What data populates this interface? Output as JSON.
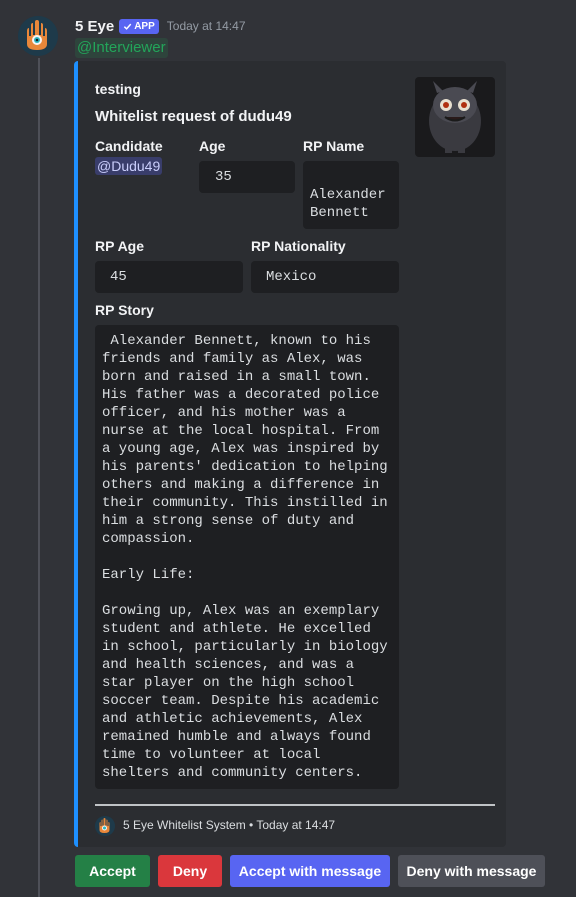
{
  "message": {
    "username": "5 Eye",
    "badge": "APP",
    "timestamp": "Today at 14:47",
    "mention": "@Interviewer"
  },
  "embed": {
    "accent_color": "#1e90ff",
    "author": "testing",
    "title": "Whitelist request of dudu49",
    "fields": {
      "candidate": {
        "name": "Candidate",
        "value": "@Dudu49"
      },
      "age": {
        "name": "Age",
        "value": "35"
      },
      "rp_name": {
        "name": "RP Name",
        "value_line1": "Alexander",
        "value_line2": "Bennett"
      },
      "rp_age": {
        "name": "RP Age",
        "value": "45"
      },
      "rp_nationality": {
        "name": "RP Nationality",
        "value": "Mexico"
      },
      "rp_story": {
        "name": "RP Story",
        "value": " Alexander Bennett, known to his\nfriends and family as Alex, was\nborn and raised in a small town.\nHis father was a decorated police\nofficer, and his mother was a\nnurse at the local hospital. From\na young age, Alex was inspired by\nhis parents' dedication to helping\nothers and making a difference in\ntheir community. This instilled in\nhim a strong sense of duty and\ncompassion.\n\nEarly Life:\n\nGrowing up, Alex was an exemplary\nstudent and athlete. He excelled\nin school, particularly in biology\nand health sciences, and was a\nstar player on the high school\nsoccer team. Despite his academic\nand athletic achievements, Alex\nremained humble and always found\ntime to volunteer at local\nshelters and community centers."
      }
    },
    "footer": "5 Eye Whitelist System • Today at 14:47"
  },
  "buttons": {
    "accept": "Accept",
    "deny": "Deny",
    "accept_with_message": "Accept with message",
    "deny_with_message": "Deny with message"
  },
  "colors": {
    "background": "#313338",
    "embed_bg": "#2b2d31",
    "accept": "#248046",
    "deny": "#da373c",
    "accept_msg": "#5865f2",
    "deny_msg": "#4e5058"
  }
}
